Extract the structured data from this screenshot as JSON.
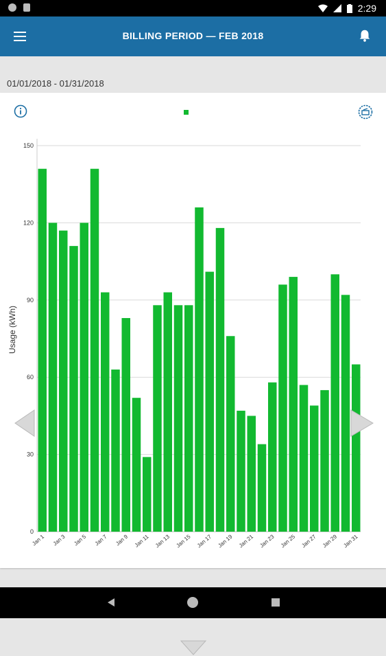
{
  "status_bar": {
    "time": "2:29"
  },
  "app_bar": {
    "title": "BILLING PERIOD  —  FEB 2018",
    "menu_icon": "hamburger-menu-icon",
    "bell_icon": "bell-icon"
  },
  "date_range": "01/01/2018 - 01/31/2018",
  "colors": {
    "app_bar": "#1c6ea4",
    "bar": "#12b930",
    "gridline": "#d9d9d9"
  },
  "chart_data": {
    "type": "bar",
    "ylabel": "Usage (kWh)",
    "ylim": [
      0,
      150
    ],
    "yticks": [
      0,
      30,
      60,
      90,
      120,
      150
    ],
    "grid": true,
    "categories": [
      "Jan 1",
      "Jan 2",
      "Jan 3",
      "Jan 4",
      "Jan 5",
      "Jan 6",
      "Jan 7",
      "Jan 8",
      "Jan 9",
      "Jan 10",
      "Jan 11",
      "Jan 12",
      "Jan 13",
      "Jan 14",
      "Jan 15",
      "Jan 16",
      "Jan 17",
      "Jan 18",
      "Jan 19",
      "Jan 20",
      "Jan 21",
      "Jan 22",
      "Jan 23",
      "Jan 24",
      "Jan 25",
      "Jan 26",
      "Jan 27",
      "Jan 28",
      "Jan 29",
      "Jan 30",
      "Jan 31"
    ],
    "xtick_labels": [
      "Jan 1",
      "Jan 3",
      "Jan 5",
      "Jan 7",
      "Jan 9",
      "Jan 11",
      "Jan 13",
      "Jan 15",
      "Jan 17",
      "Jan 19",
      "Jan 21",
      "Jan 23",
      "Jan 25",
      "Jan 27",
      "Jan 29",
      "Jan 31"
    ],
    "values": [
      141,
      120,
      117,
      111,
      120,
      141,
      93,
      63,
      83,
      52,
      29,
      88,
      93,
      88,
      88,
      126,
      101,
      118,
      76,
      47,
      45,
      34,
      58,
      96,
      99,
      57,
      49,
      55,
      100,
      92,
      65
    ]
  }
}
